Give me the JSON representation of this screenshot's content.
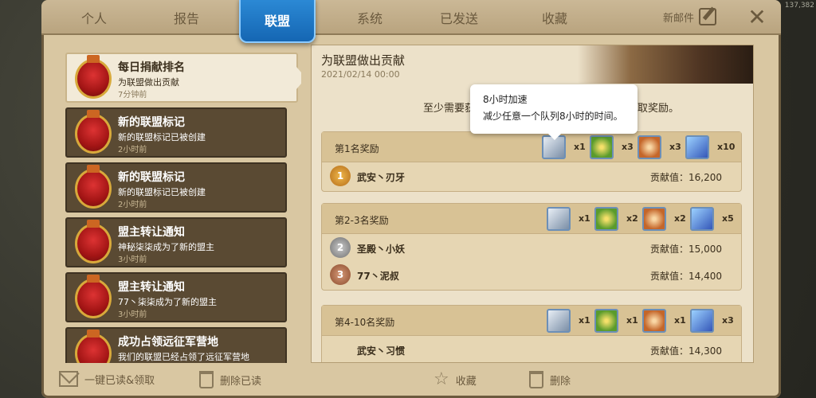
{
  "world": {
    "coordinate_text": "137,382"
  },
  "tabs": [
    {
      "label": "个人"
    },
    {
      "label": "报告"
    },
    {
      "label": "联盟"
    },
    {
      "label": "系统"
    },
    {
      "label": "已发送"
    },
    {
      "label": "收藏"
    }
  ],
  "header": {
    "new_mail": "新邮件",
    "close": "✕"
  },
  "mail_list": [
    {
      "title": "每日捐献排名",
      "subtitle": "为联盟做出贡献",
      "time": "7分钟前"
    },
    {
      "title": "新的联盟标记",
      "subtitle": "新的联盟标记已被创建",
      "time": "2小时前"
    },
    {
      "title": "新的联盟标记",
      "subtitle": "新的联盟标记已被创建",
      "time": "2小时前"
    },
    {
      "title": "盟主转让通知",
      "subtitle": "神秘柒柒成为了新的盟主",
      "time": "3小时前"
    },
    {
      "title": "盟主转让通知",
      "subtitle": "77丶柒柒成为了新的盟主",
      "time": "3小时前"
    },
    {
      "title": "成功占领远征军营地",
      "subtitle": "我们的联盟已经占领了远征军营地",
      "time": ""
    }
  ],
  "detail": {
    "title": "为联盟做出贡献",
    "date": "2021/02/14 00:00",
    "notice": "至少需要获",
    "notice_tail": "贡献值才能领取奖励。",
    "blocks": [
      {
        "label": "第1名奖励",
        "items": [
          {
            "icon": "speedup-icon",
            "qty": "x1"
          },
          {
            "icon": "food-icon",
            "qty": "x3"
          },
          {
            "icon": "wood-icon",
            "qty": "x3"
          },
          {
            "icon": "tome-icon",
            "qty": "x10"
          }
        ],
        "ranks": [
          {
            "medal": "1",
            "name": "武安丶刃牙",
            "score": "贡献值：16,200"
          }
        ]
      },
      {
        "label": "第2-3名奖励",
        "items": [
          {
            "icon": "speedup-icon",
            "qty": "x1"
          },
          {
            "icon": "food-icon",
            "qty": "x2"
          },
          {
            "icon": "wood-icon",
            "qty": "x2"
          },
          {
            "icon": "tome-icon",
            "qty": "x5"
          }
        ],
        "ranks": [
          {
            "medal": "2",
            "name": "圣殿丶小妖",
            "score": "贡献值：15,000"
          },
          {
            "medal": "3",
            "name": "77丶泥叔",
            "score": "贡献值：14,400"
          }
        ]
      },
      {
        "label": "第4-10名奖励",
        "items": [
          {
            "icon": "speedup-icon",
            "qty": "x1"
          },
          {
            "icon": "food-icon",
            "qty": "x1"
          },
          {
            "icon": "wood-icon",
            "qty": "x1"
          },
          {
            "icon": "tome-icon",
            "qty": "x3"
          }
        ],
        "ranks": [
          {
            "medal": "",
            "name": "武安丶习惯",
            "score": "贡献值：14,300"
          }
        ]
      }
    ]
  },
  "tooltip": {
    "title": "8小时加速",
    "desc": "减少任意一个队列8小时的时间。"
  },
  "footer": {
    "read_all": "一键已读&领取",
    "delete_read": "删除已读",
    "favorite": "收藏",
    "delete": "删除"
  },
  "colors": {
    "tab_active": "#1f78c8",
    "panel": "#d9c7a2",
    "list_item": "#5a4a33"
  }
}
